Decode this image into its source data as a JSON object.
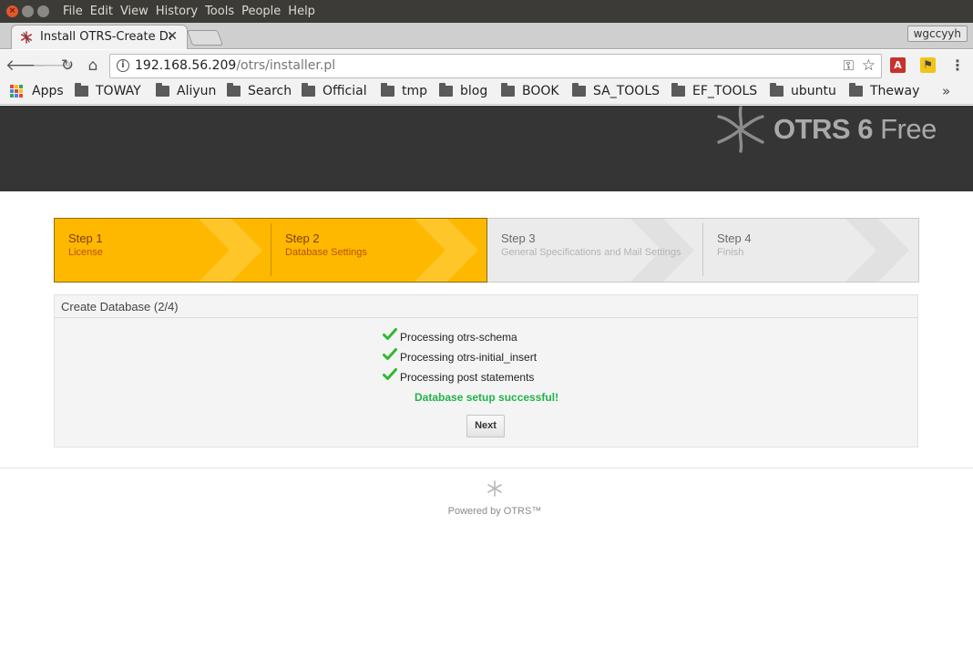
{
  "os": {
    "menu": [
      "File",
      "Edit",
      "View",
      "History",
      "Tools",
      "People",
      "Help"
    ]
  },
  "browser": {
    "tab_title": "Install OTRS-Create Database",
    "tab_close": "✕",
    "profile_name": "wgccyyh",
    "url_host": "192.168.56.209",
    "url_path": "/otrs/installer.pl",
    "bookmarks": [
      "Apps",
      "TOWAY",
      "Aliyun",
      "Search",
      "Official",
      "tmp",
      "blog",
      "BOOK",
      "SA_TOOLS",
      "EF_TOOLS",
      "ubuntu",
      "Theway"
    ],
    "bookmarks_more": "»",
    "icons": {
      "back": "arrow-left-icon",
      "forward": "arrow-right-icon",
      "reload": "reload-icon",
      "home": "home-icon",
      "info": "info-icon",
      "key": "key-icon",
      "star": "star-icon",
      "menu": "kebab-menu-icon"
    }
  },
  "otrs": {
    "logo": "OTRS 6",
    "logo_free": "Free",
    "steps": [
      {
        "title": "Step 1",
        "subtitle": "License",
        "state": "done"
      },
      {
        "title": "Step 2",
        "subtitle": "Database Settings",
        "state": "active"
      },
      {
        "title": "Step 3",
        "subtitle": "General Specifications and Mail Settings",
        "state": "pending"
      },
      {
        "title": "Step 4",
        "subtitle": "Finish",
        "state": "pending"
      }
    ],
    "box_title": "Create Database (2/4)",
    "processing": [
      "Processing otrs-schema",
      "Processing otrs-initial_insert",
      "Processing post statements"
    ],
    "success_message": "Database setup successful!",
    "next_button": "Next",
    "footer": "Powered by OTRS™",
    "colors": {
      "header_bg": "#353535",
      "step_active": "#ffb800",
      "success": "#21b34a",
      "check": "#2fb82f"
    }
  }
}
